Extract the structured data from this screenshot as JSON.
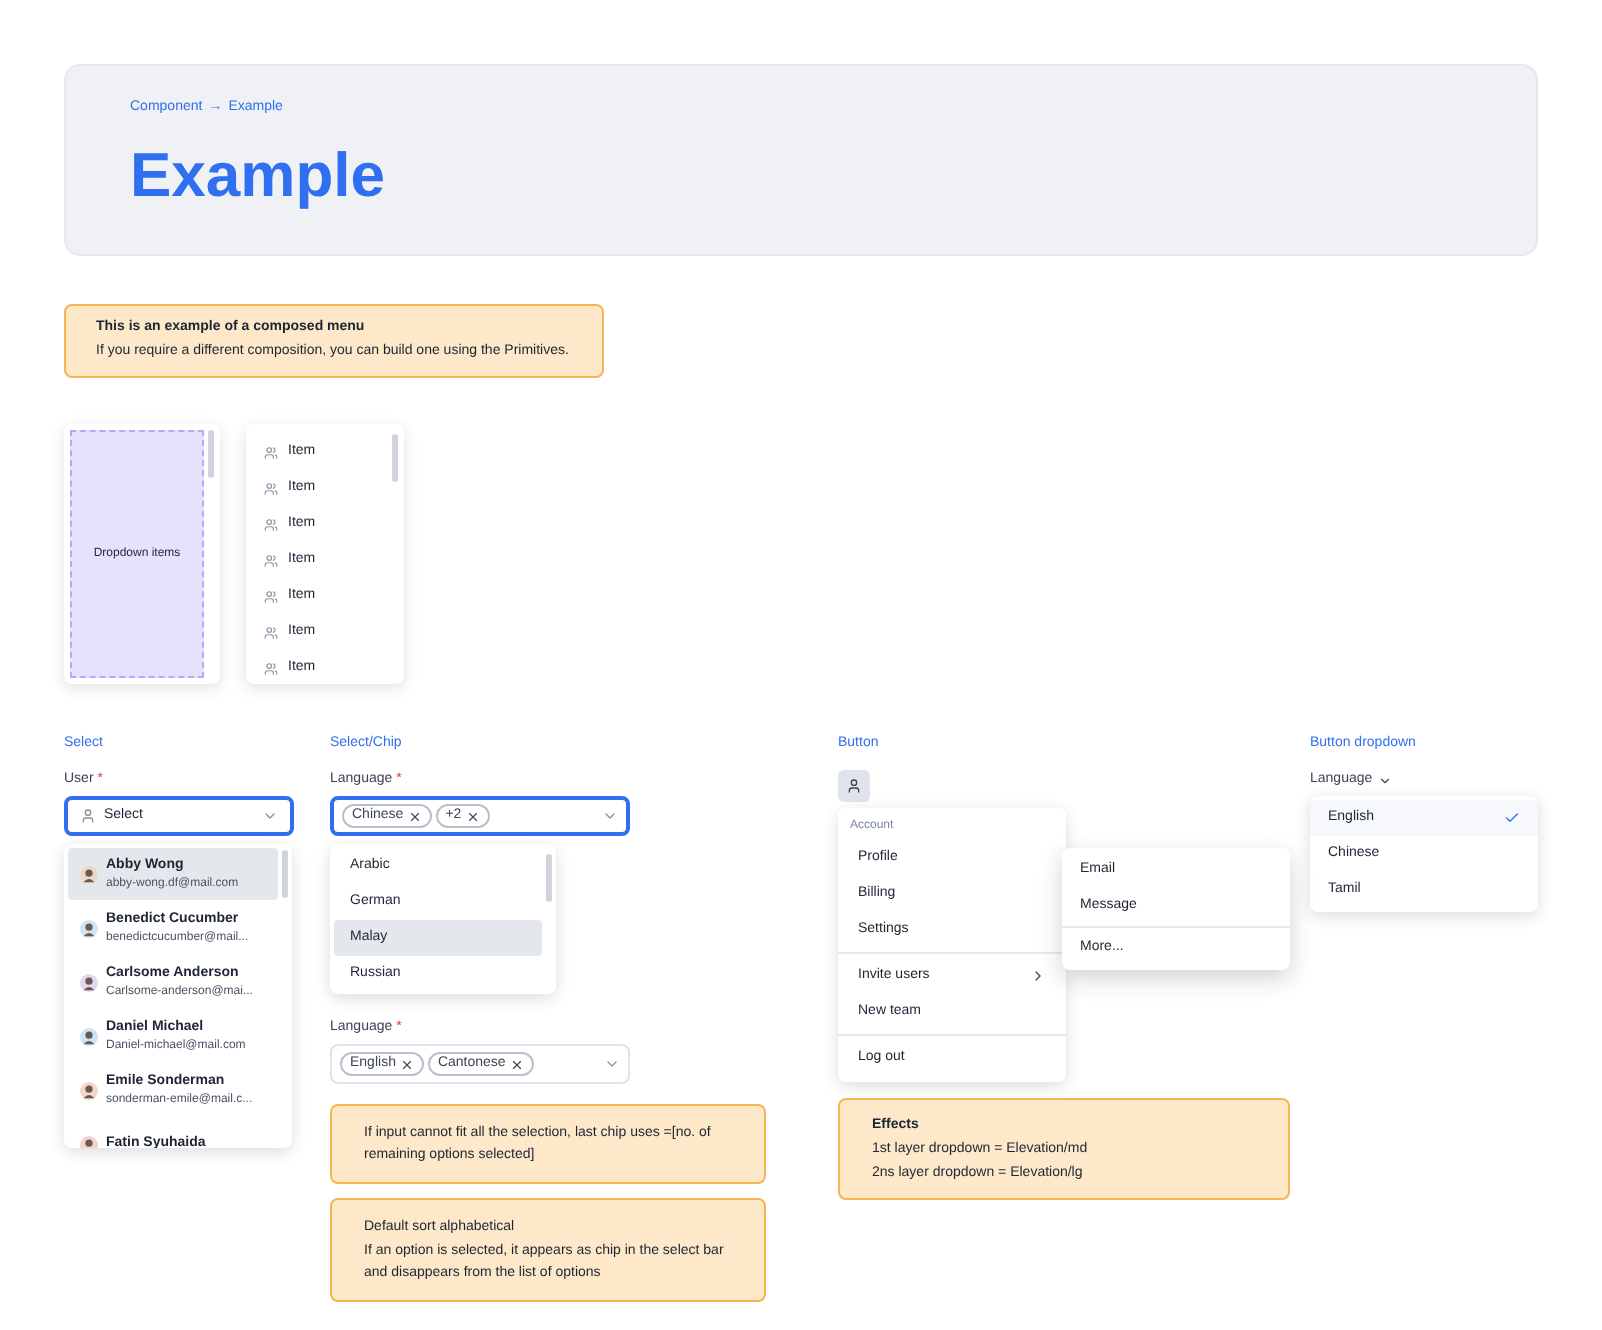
{
  "breadcrumb": {
    "parent": "Component",
    "arrow": "→",
    "current": "Example"
  },
  "title": "Example",
  "intro_note": {
    "title": "This is an example of a composed menu",
    "text": "If you require a different composition, you can build one using the Primitives."
  },
  "placeholder_menu": {
    "label": "Dropdown items"
  },
  "item_menu": {
    "items": [
      "Item",
      "Item",
      "Item",
      "Item",
      "Item",
      "Item",
      "Item"
    ]
  },
  "select_section": {
    "heading": "Select",
    "label": "User",
    "required_mark": "*",
    "placeholder": "Select",
    "focused": true,
    "options": [
      {
        "name": "Abby Wong",
        "email": "abby-wong.df@mail.com",
        "selected": true,
        "color": "#e8d9c8"
      },
      {
        "name": "Benedict Cucumber",
        "email": "benedictcucumber@mail...",
        "selected": false,
        "color": "#cde6f5"
      },
      {
        "name": "Carlsome Anderson",
        "email": "Carlsome-anderson@mai...",
        "selected": false,
        "color": "#e2d6f2"
      },
      {
        "name": "Daniel Michael",
        "email": "Daniel-michael@mail.com",
        "selected": false,
        "color": "#c9e4f7"
      },
      {
        "name": "Emile Sonderman",
        "email": "sonderman-emile@mail.c...",
        "selected": false,
        "color": "#f3d7cc"
      },
      {
        "name": "Fatin Syuhaida",
        "selected": false,
        "color": "#f7d0d3"
      }
    ]
  },
  "chip_section": {
    "heading": "Select/Chip",
    "fields": [
      {
        "label": "Language",
        "required_mark": "*",
        "focused": true,
        "chips": [
          "Chinese",
          "+2"
        ],
        "options": [
          {
            "label": "Arabic",
            "selected": false
          },
          {
            "label": "German",
            "selected": false
          },
          {
            "label": "Malay",
            "selected": true
          },
          {
            "label": "Russian",
            "selected": false
          }
        ]
      },
      {
        "label": "Language",
        "required_mark": "*",
        "focused": false,
        "chips": [
          "English",
          "Cantonese"
        ]
      }
    ],
    "notes": [
      {
        "lines": [
          "If input cannot fit all the selection, last chip uses =[no. of remaining options selected]"
        ]
      },
      {
        "lines": [
          "Default sort alphabetical",
          "If an option is selected, it appears as chip in the select bar and disappears from the list of options"
        ]
      }
    ]
  },
  "button_section": {
    "heading": "Button",
    "menu": {
      "group_label": "Account",
      "groups": [
        [
          {
            "label": "Profile",
            "has_submenu": false
          },
          {
            "label": "Billing",
            "has_submenu": false
          },
          {
            "label": "Settings",
            "has_submenu": false
          }
        ],
        [
          {
            "label": "Invite users",
            "has_submenu": true
          },
          {
            "label": "New team",
            "has_submenu": false
          }
        ],
        [
          {
            "label": "Log out",
            "has_submenu": false
          }
        ]
      ]
    },
    "submenu": {
      "groups": [
        [
          "Email",
          "Message"
        ],
        [
          "More..."
        ]
      ]
    },
    "note": {
      "title": "Effects",
      "lines": [
        "1st layer dropdown = Elevation/md",
        "2ns layer dropdown = Elevation/lg"
      ]
    }
  },
  "button_dropdown_section": {
    "heading": "Button dropdown",
    "trigger": "Language",
    "options": [
      {
        "label": "English",
        "selected": true
      },
      {
        "label": "Chinese",
        "selected": false
      },
      {
        "label": "Tamil",
        "selected": false
      }
    ]
  }
}
